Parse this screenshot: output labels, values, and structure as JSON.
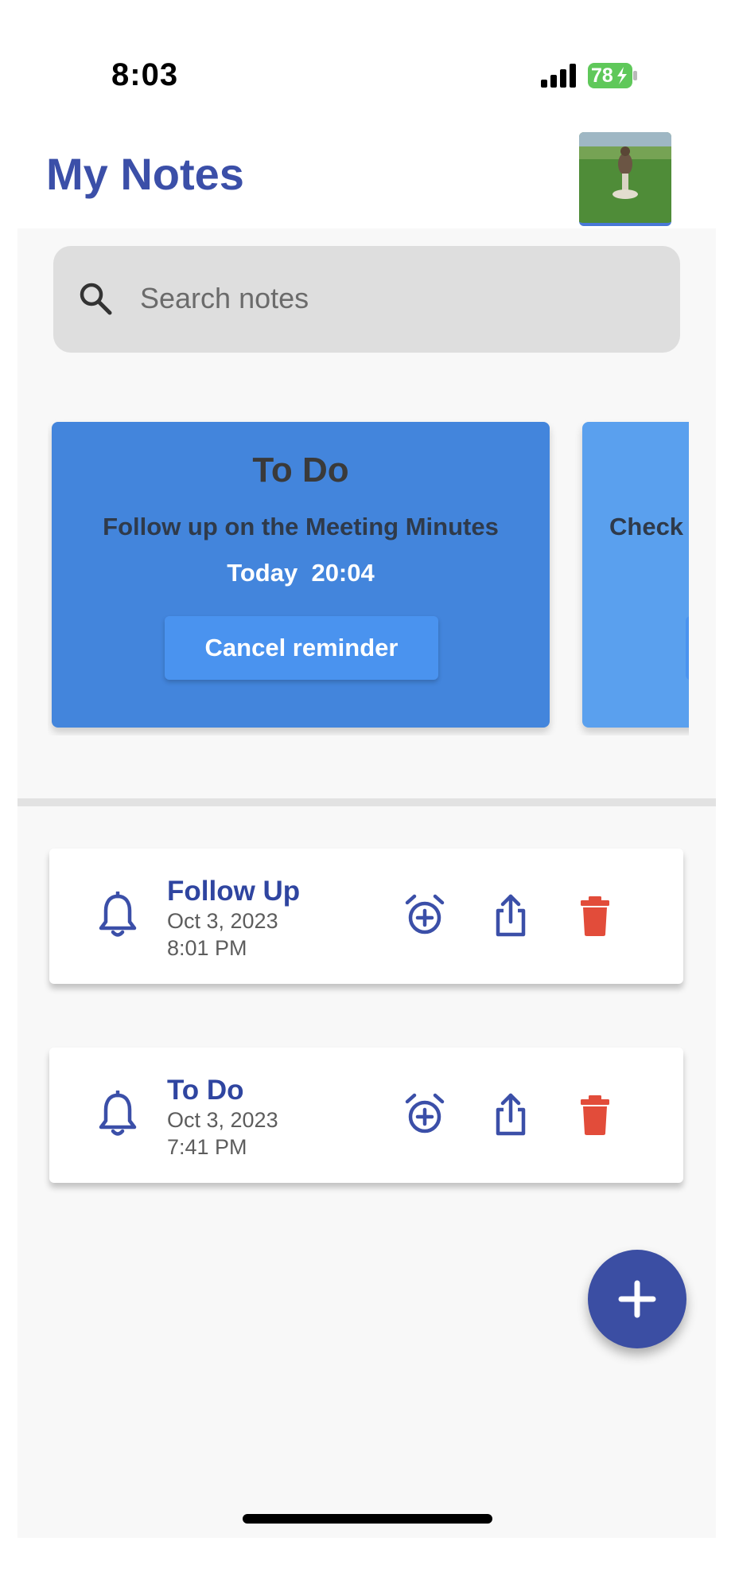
{
  "status_bar": {
    "time": "8:03",
    "battery": "78"
  },
  "header": {
    "title": "My Notes"
  },
  "search": {
    "placeholder": "Search notes"
  },
  "reminder_cards": [
    {
      "title": "To Do",
      "note": "Follow up on the Meeting Minutes",
      "time": "Today  20:04",
      "button": "Cancel reminder"
    },
    {
      "title": "",
      "note": "Check",
      "time": "",
      "button": ""
    }
  ],
  "notes": [
    {
      "title": "Follow Up",
      "date": "Oct 3, 2023",
      "time": "8:01 PM"
    },
    {
      "title": "To Do",
      "date": "Oct 3, 2023",
      "time": "7:41 PM"
    }
  ],
  "colors": {
    "accent": "#3b4fa8",
    "card": "#4385dc",
    "delete": "#e24c3a"
  },
  "icons": [
    "search-icon",
    "bell-icon",
    "alarm-add-icon",
    "share-icon",
    "trash-icon",
    "plus-icon"
  ]
}
